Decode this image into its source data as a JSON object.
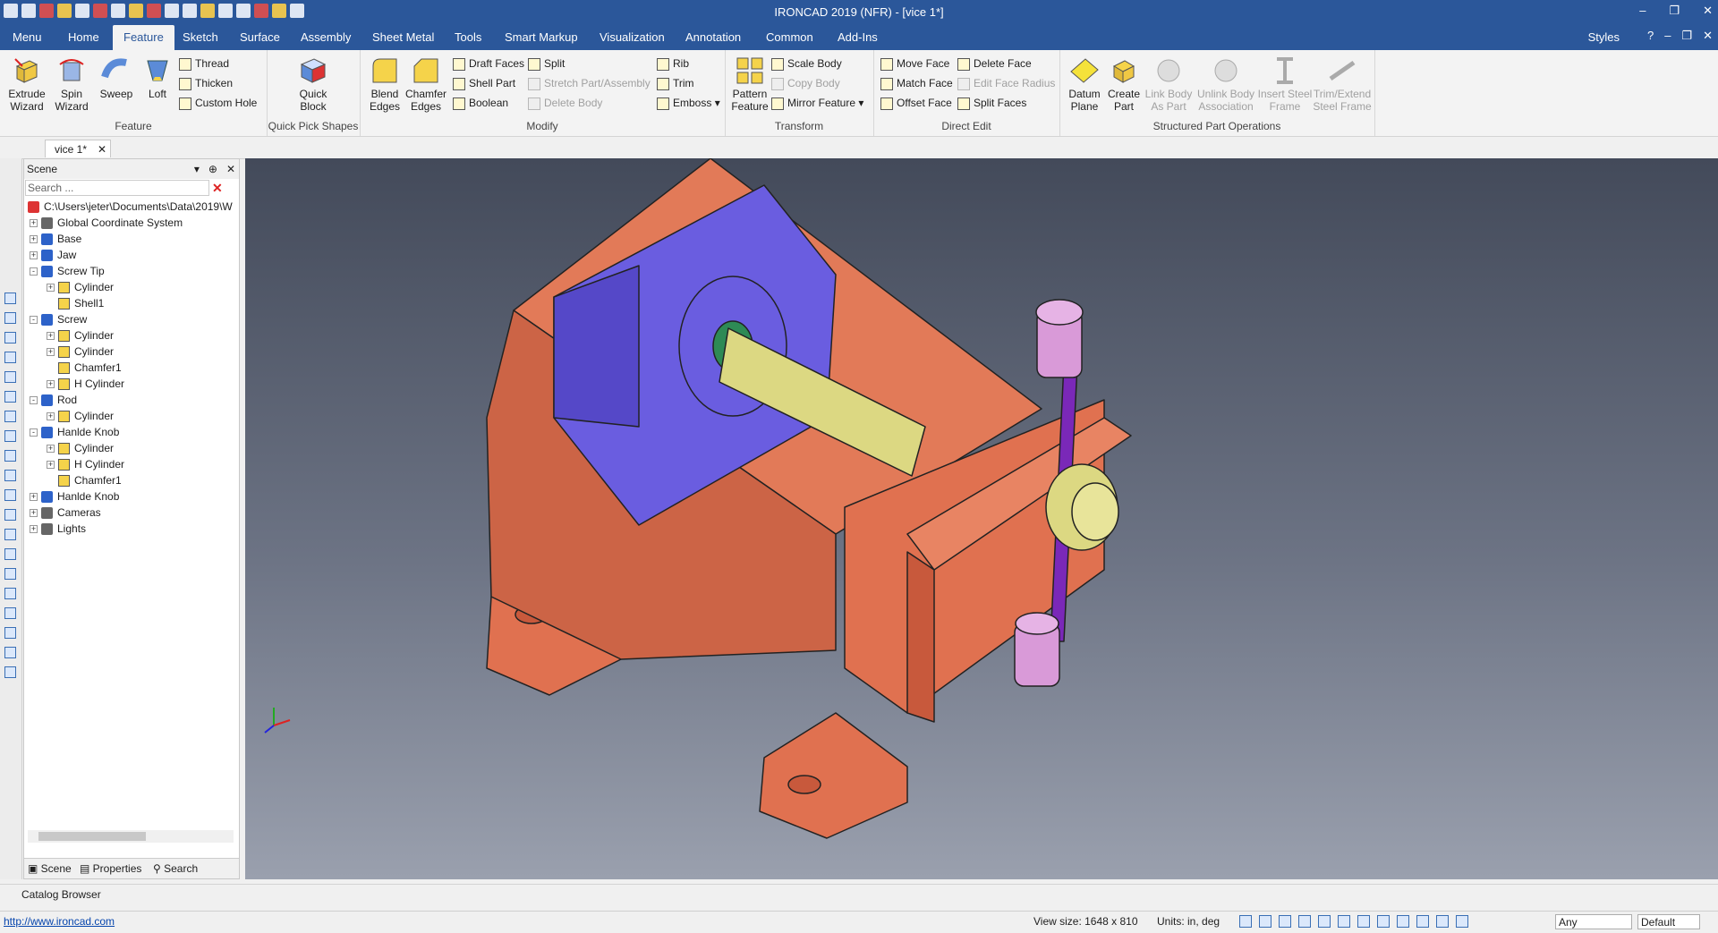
{
  "window": {
    "title": "IRONCAD 2019 (NFR) - [vice 1*]"
  },
  "menu_tabs": [
    "Menu",
    "Home",
    "Feature",
    "Sketch",
    "Surface",
    "Assembly",
    "Sheet Metal",
    "Tools",
    "Smart Markup",
    "Visualization",
    "Annotation",
    "Common",
    "Add-Ins"
  ],
  "styles_label": "Styles",
  "ribbon": {
    "feature": {
      "label": "Feature",
      "extrude": "Extrude Wizard",
      "spin": "Spin Wizard",
      "sweep": "Sweep",
      "loft": "Loft",
      "thread": "Thread",
      "thicken": "Thicken",
      "custom_hole": "Custom Hole"
    },
    "quickpick": {
      "label": "Quick Pick Shapes",
      "quick_block": "Quick Block"
    },
    "modify": {
      "label": "Modify",
      "blend": "Blend Edges",
      "chamfer": "Chamfer Edges",
      "draft": "Draft Faces",
      "shell": "Shell Part",
      "boolean": "Boolean",
      "split": "Split",
      "stretch": "Stretch Part/Assembly",
      "delete_body": "Delete Body",
      "rib": "Rib",
      "trim": "Trim",
      "emboss": "Emboss"
    },
    "transform": {
      "label": "Transform",
      "pattern": "Pattern Feature",
      "scale": "Scale Body",
      "copy": "Copy Body",
      "mirror": "Mirror Feature"
    },
    "directedit": {
      "label": "Direct Edit",
      "move": "Move Face",
      "match": "Match Face",
      "offset": "Offset Face",
      "delete_face": "Delete Face",
      "edit_radius": "Edit Face Radius",
      "split_faces": "Split Faces"
    },
    "structured": {
      "label": "Structured Part Operations",
      "datum": "Datum Plane",
      "create": "Create Part",
      "link": "Link Body As Part",
      "unlink": "Unlink Body Association",
      "steel": "Insert Steel Frame",
      "trim_steel": "Trim/Extend Steel Frame"
    }
  },
  "doc_tab": {
    "label": "vice 1*"
  },
  "scene": {
    "title": "Scene",
    "search_placeholder": "Search ...",
    "path": "C:\\Users\\jeter\\Documents\\Data\\2019\\W",
    "nodes": [
      {
        "label": "Global Coordinate System",
        "level": 0,
        "kind": "other",
        "expander": "+"
      },
      {
        "label": "Base",
        "level": 0,
        "kind": "asm",
        "expander": "+"
      },
      {
        "label": "Jaw",
        "level": 0,
        "kind": "asm",
        "expander": "+"
      },
      {
        "label": "Screw Tip",
        "level": 0,
        "kind": "asm",
        "expander": "-"
      },
      {
        "label": "Cylinder",
        "level": 1,
        "kind": "part",
        "expander": "+"
      },
      {
        "label": "Shell1",
        "level": 1,
        "kind": "part",
        "expander": ""
      },
      {
        "label": "Screw",
        "level": 0,
        "kind": "asm",
        "expander": "-"
      },
      {
        "label": "Cylinder",
        "level": 1,
        "kind": "part",
        "expander": "+"
      },
      {
        "label": "Cylinder",
        "level": 1,
        "kind": "part",
        "expander": "+"
      },
      {
        "label": "Chamfer1",
        "level": 1,
        "kind": "part",
        "expander": ""
      },
      {
        "label": "H Cylinder",
        "level": 1,
        "kind": "part",
        "expander": "+"
      },
      {
        "label": "Rod",
        "level": 0,
        "kind": "asm",
        "expander": "-"
      },
      {
        "label": "Cylinder",
        "level": 1,
        "kind": "part",
        "expander": "+"
      },
      {
        "label": "Hanlde Knob",
        "level": 0,
        "kind": "asm",
        "expander": "-"
      },
      {
        "label": "Cylinder",
        "level": 1,
        "kind": "part",
        "expander": "+"
      },
      {
        "label": "H Cylinder",
        "level": 1,
        "kind": "part",
        "expander": "+"
      },
      {
        "label": "Chamfer1",
        "level": 1,
        "kind": "part",
        "expander": ""
      },
      {
        "label": "Hanlde Knob",
        "level": 0,
        "kind": "asm",
        "expander": "+"
      },
      {
        "label": "Cameras",
        "level": 0,
        "kind": "other",
        "expander": "+"
      },
      {
        "label": "Lights",
        "level": 0,
        "kind": "other",
        "expander": "+"
      }
    ],
    "tabs": [
      "Scene",
      "Properties",
      "Search"
    ]
  },
  "catalog_browser": "Catalog Browser",
  "status": {
    "url": "http://www.ironcad.com",
    "view_size": "View size: 1648 x 810",
    "units": "Units: in, deg",
    "filter": "Any",
    "style": "Default"
  }
}
